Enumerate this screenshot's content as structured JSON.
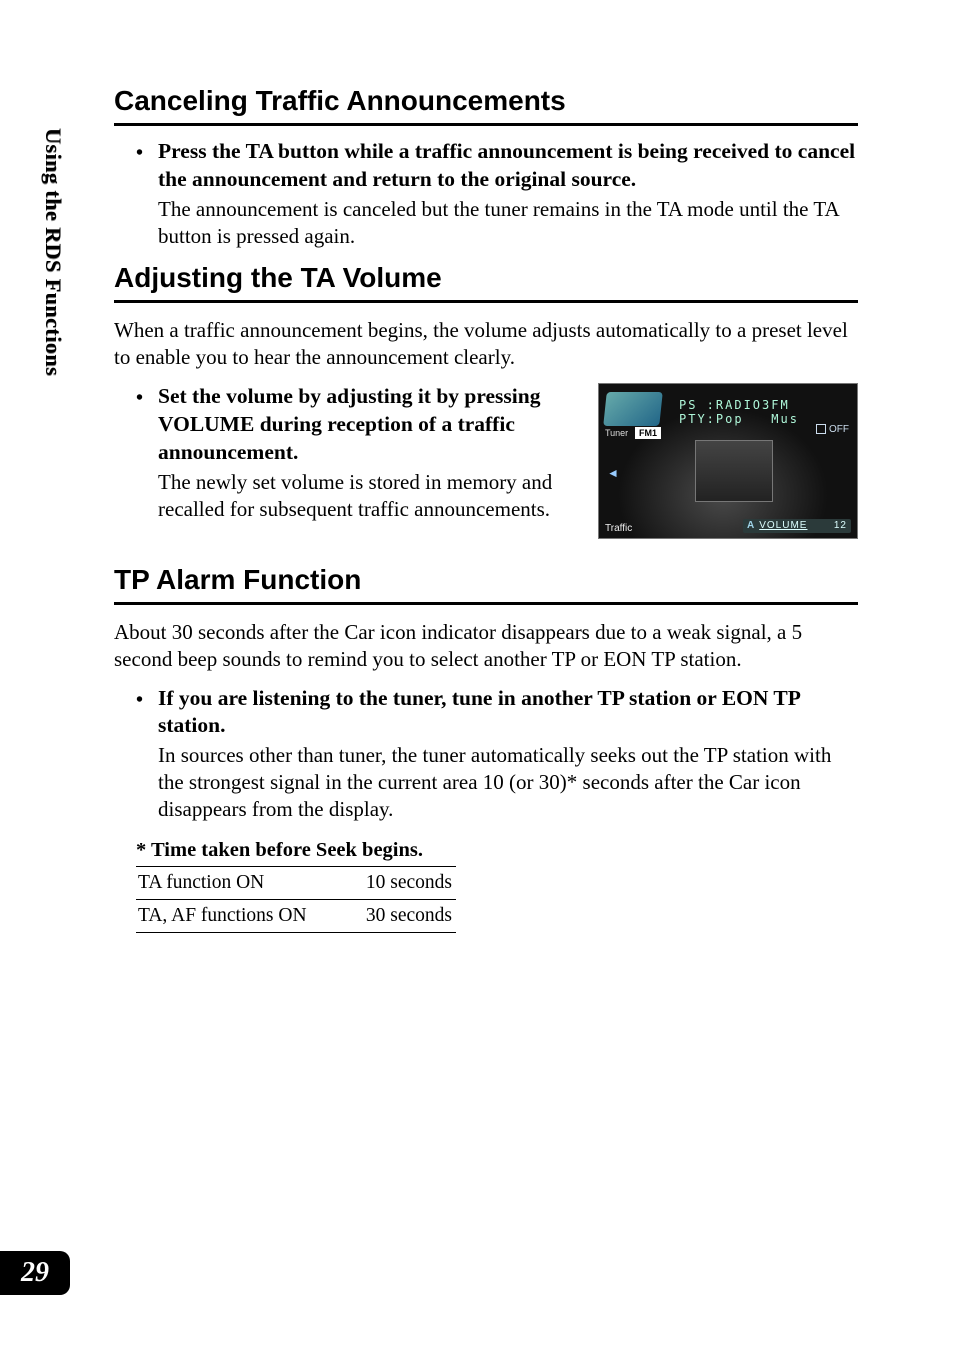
{
  "side_tab": "Using the RDS Functions",
  "page_number": "29",
  "sec_cancel": {
    "heading": "Canceling Traffic Announcements",
    "bullet_bold": "Press the TA button while a traffic announcement is being received to cancel the announcement and return to the original source.",
    "bullet_plain": "The announcement is canceled but the tuner remains in the TA mode until the TA button is pressed again."
  },
  "sec_volume": {
    "heading": "Adjusting the TA Volume",
    "intro": "When a traffic announcement begins, the volume adjusts automatically to a preset level to enable you to hear the announcement clearly.",
    "bullet_bold": "Set the volume by adjusting it by pressing VOLUME during reception of a traffic announcement.",
    "bullet_plain": "The newly set volume is stored in memory and recalled for subsequent traffic announcements."
  },
  "screenshot": {
    "band_label": "Tuner",
    "band_value": "FM1",
    "line1": "PS :RADIO3FM",
    "line2": "PTY:Pop   Mus",
    "off": "OFF",
    "traffic": "Traffic",
    "vol_prefix": "A",
    "vol_label": "VOLUME",
    "vol_value": "12"
  },
  "sec_tp": {
    "heading": "TP Alarm Function",
    "intro": "About 30 seconds after the Car icon indicator disappears due to a weak signal, a 5 second beep sounds to remind you to select another TP or EON TP station.",
    "bullet_bold": "If you are listening to the tuner, tune in another TP station or EON TP station.",
    "bullet_plain": "In sources other than tuner, the tuner automatically seeks out the TP station with the strongest signal in the current area 10 (or 30)* seconds after the Car icon disappears from the display."
  },
  "seek_table": {
    "caption": "* Time taken before Seek begins.",
    "rows": [
      {
        "label": "TA function ON",
        "value": "10 seconds"
      },
      {
        "label": "TA, AF functions ON",
        "value": "30 seconds"
      }
    ]
  }
}
